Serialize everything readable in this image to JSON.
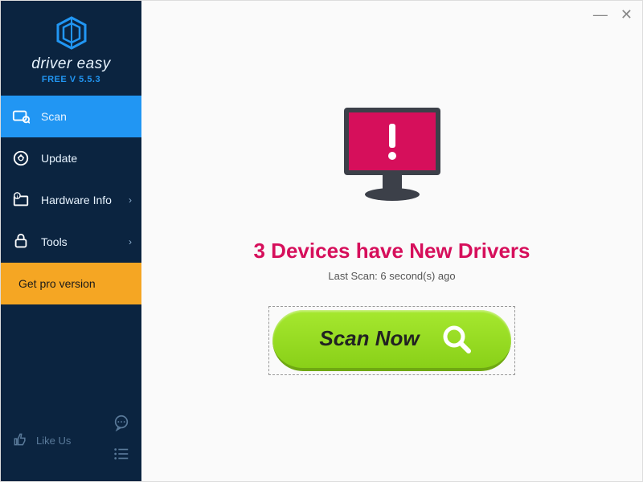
{
  "brand": {
    "name": "driver easy",
    "version": "FREE V 5.5.3"
  },
  "sidebar": {
    "items": [
      {
        "label": "Scan",
        "has_chevron": false
      },
      {
        "label": "Update",
        "has_chevron": false
      },
      {
        "label": "Hardware Info",
        "has_chevron": true
      },
      {
        "label": "Tools",
        "has_chevron": true
      }
    ],
    "pro_label": "Get pro version",
    "like_label": "Like Us"
  },
  "main": {
    "headline": "3 Devices have New Drivers",
    "subtext": "Last Scan: 6 second(s) ago",
    "scan_button_label": "Scan Now"
  },
  "colors": {
    "accent_pink": "#d60f5b",
    "accent_blue": "#2196f3",
    "sidebar_bg": "#0b2440",
    "scan_green": "#a6e82f"
  }
}
